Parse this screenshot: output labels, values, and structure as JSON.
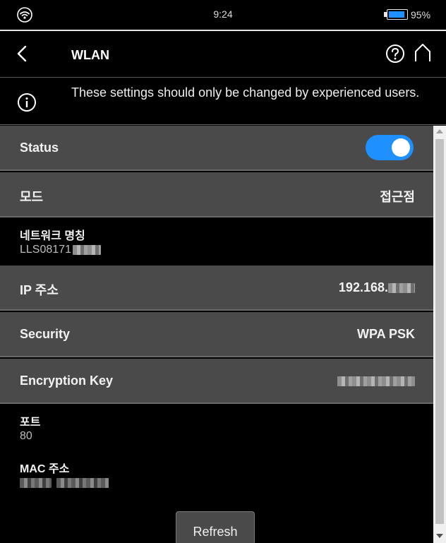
{
  "status_bar": {
    "time": "9:24",
    "battery_percent": "95%",
    "battery_level": 0.95
  },
  "header": {
    "title": "WLAN",
    "icons": [
      "back-icon",
      "help-icon",
      "home-icon"
    ]
  },
  "info": {
    "text": "These settings should only be changed by experienced users."
  },
  "settings": {
    "status": {
      "label": "Status",
      "enabled": true
    },
    "mode": {
      "label": "모드",
      "value": "접근점"
    },
    "network_name": {
      "label": "네트워크 명칭",
      "value": "LLS08171"
    },
    "ip": {
      "label": "IP 주소",
      "value": "192.168."
    },
    "security": {
      "label": "Security",
      "value": "WPA PSK"
    },
    "encryption_key": {
      "label": "Encryption Key"
    },
    "port": {
      "label": "포트",
      "value": "80"
    },
    "mac": {
      "label": "MAC 주소"
    }
  },
  "actions": {
    "refresh_label": "Refresh"
  },
  "colors": {
    "accent": "#1e90ff",
    "row_background": "#4a4a4a",
    "background": "#000000"
  }
}
